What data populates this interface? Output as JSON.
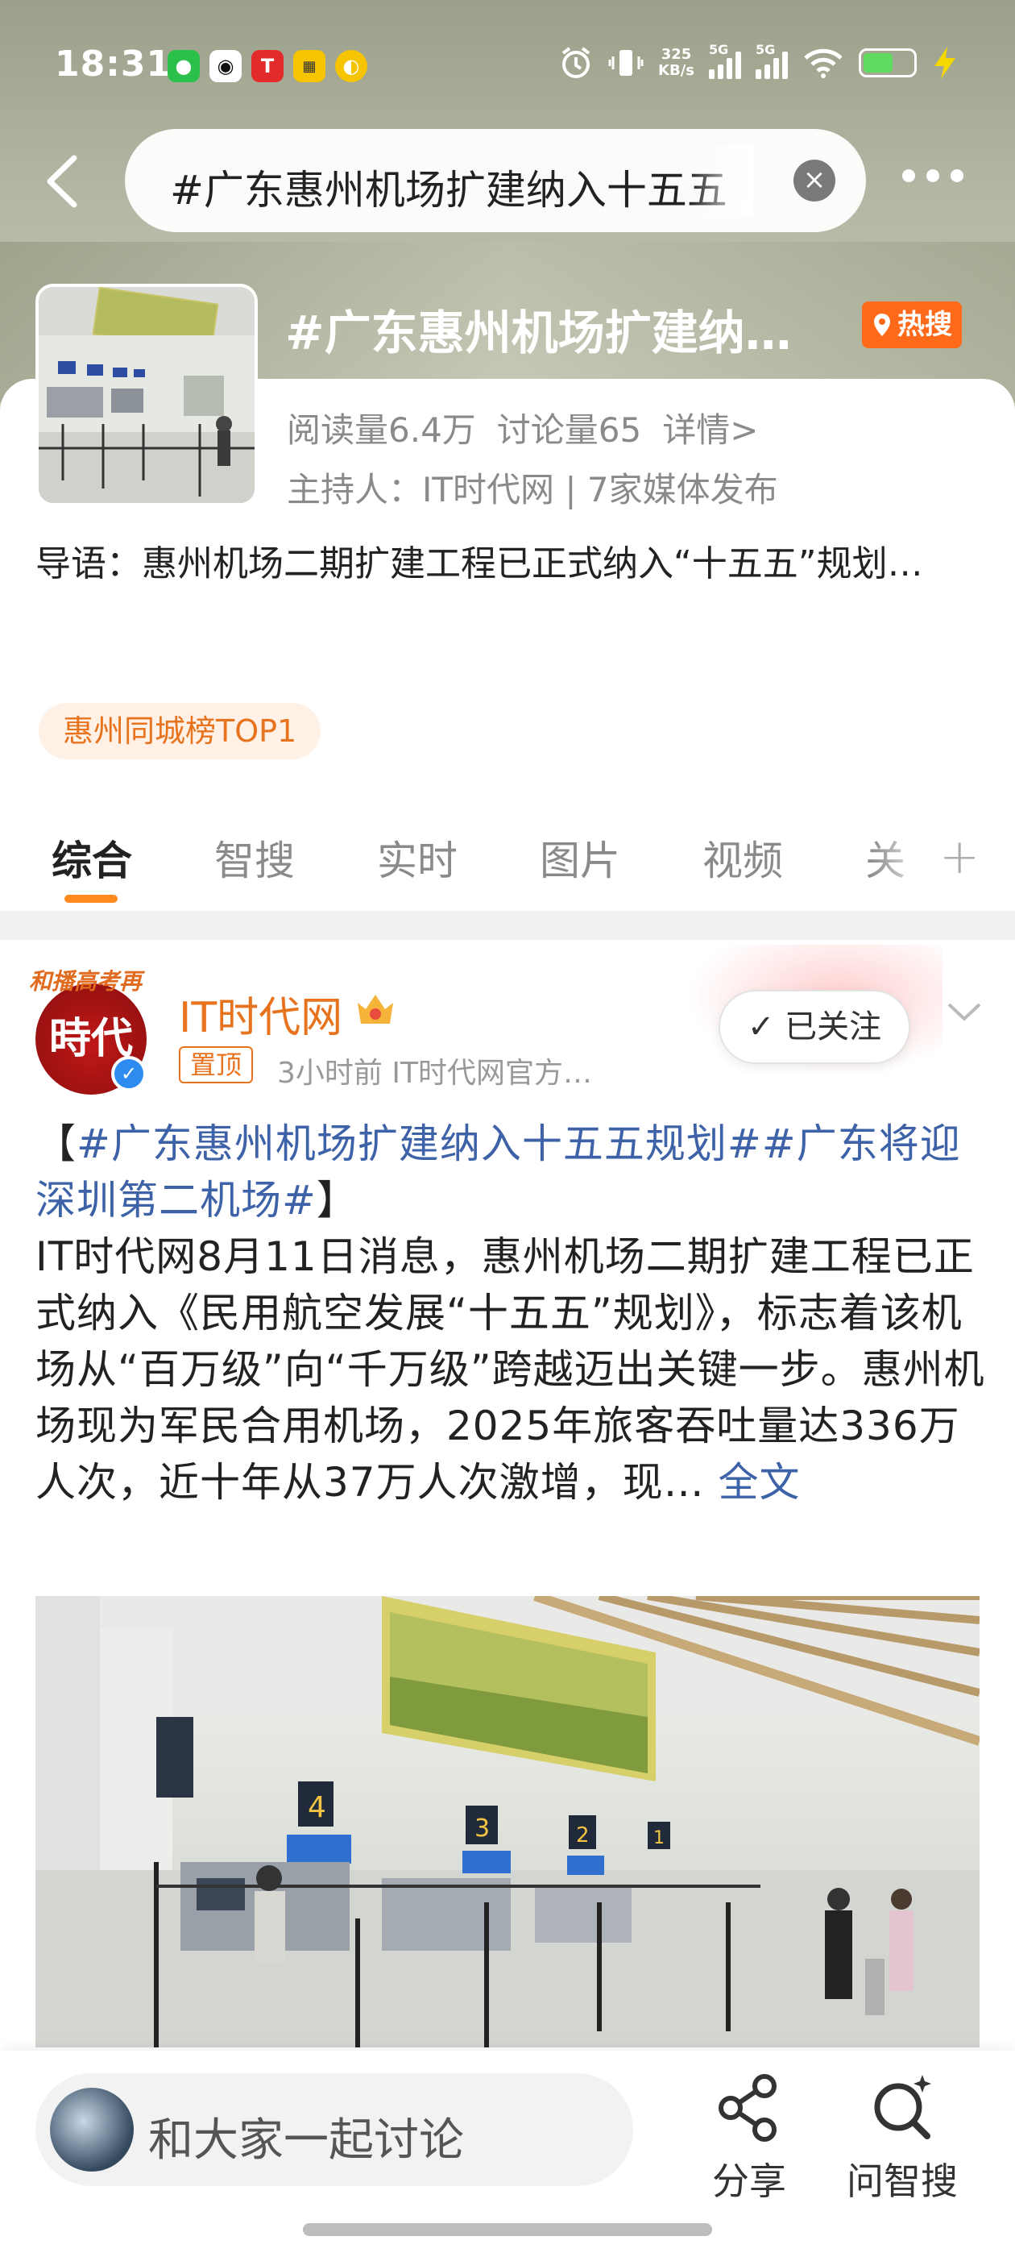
{
  "status_bar": {
    "time": "18:31",
    "net_speed_value": "325",
    "net_speed_unit": "KB/s",
    "signal1_label": "5G",
    "signal2_label": "5G",
    "icons": [
      "wechat-icon",
      "qq-icon",
      "tesla-icon",
      "app-icon",
      "app-icon",
      "alarm-icon",
      "vibrate-icon",
      "wifi-icon",
      "battery-icon",
      "charging-icon"
    ]
  },
  "search": {
    "query": "#广东惠州机场扩建纳入十五五"
  },
  "topic": {
    "title": "#广东惠州机场扩建纳…",
    "hot_badge": "热搜",
    "reads": "阅读量6.4万",
    "discussions": "讨论量65",
    "details": "详情>",
    "host_line": "主持人：IT时代网 | 7家媒体发布",
    "intro": "导语：惠州机场二期扩建工程已正式纳入“十五五”规划…",
    "rank_pill": "惠州同城榜TOP1"
  },
  "tabs": [
    "综合",
    "智搜",
    "实时",
    "图片",
    "视频",
    "关"
  ],
  "post": {
    "avatar_text": "時代",
    "avatar_caption": "和播高考再",
    "author": "IT时代网",
    "pin_label": "置顶",
    "meta": "3小时前  IT时代网官方…",
    "follow_label": "已关注",
    "hashtag_open": "【",
    "hashtag1": "#广东惠州机场扩建纳入十五五规划#",
    "hashtag2": "#广东将迎深圳第二机场#",
    "hashtag_close": "】",
    "body": "IT时代网8月11日消息，惠州机场二期扩建工程已正式纳入《民用航空发展“十五五”规划》，标志着该机场从“百万级”向“千万级”跨越迈出关键一步。惠州机场现为军民合用机场，2025年旅客吞吐量达336万人次，近十年从37万人次激增，现…",
    "more": "全文"
  },
  "bottom_bar": {
    "comment_placeholder": "和大家一起讨论",
    "share_label": "分享",
    "ask_label": "问智搜"
  }
}
